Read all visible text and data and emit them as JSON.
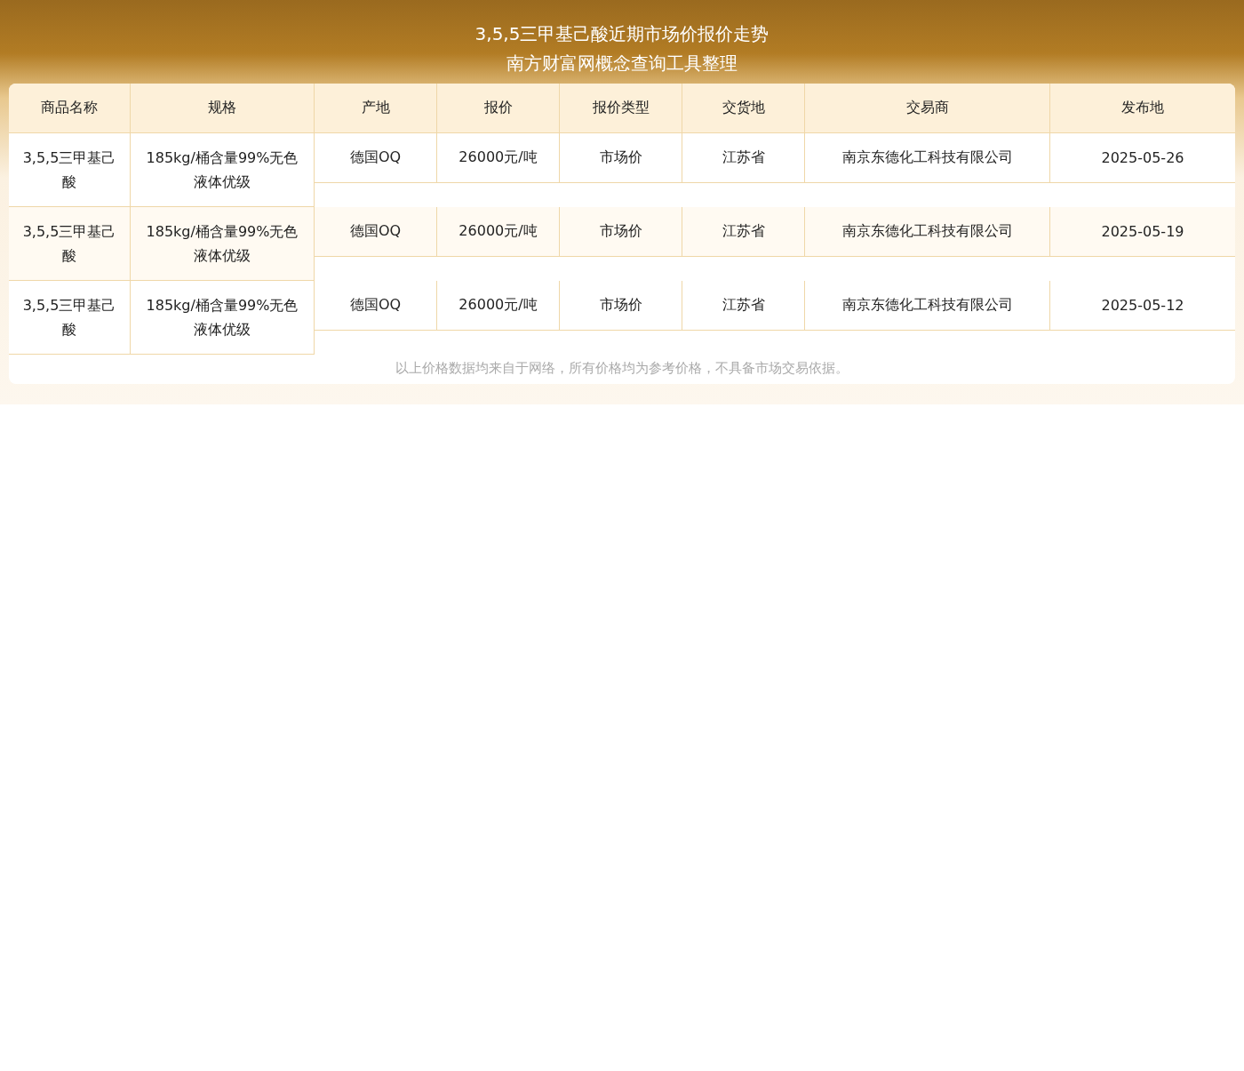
{
  "title": "3,5,5三甲基己酸近期市场价报价走势",
  "subtitle": "南方财富网概念查询工具整理",
  "table": {
    "columns": [
      "商品名称",
      "规格",
      "产地",
      "报价",
      "报价类型",
      "交货地",
      "交易商",
      "发布地"
    ],
    "rows": [
      [
        "3,5,5三甲基己酸",
        "185kg/桶含量99%无色液体优级",
        "德国OQ",
        "26000元/吨",
        "市场价",
        "江苏省",
        "南京东德化工科技有限公司",
        "2025-05-26"
      ],
      [
        "3,5,5三甲基己酸",
        "185kg/桶含量99%无色液体优级",
        "德国OQ",
        "26000元/吨",
        "市场价",
        "江苏省",
        "南京东德化工科技有限公司",
        "2025-05-19"
      ],
      [
        "3,5,5三甲基己酸",
        "185kg/桶含量99%无色液体优级",
        "德国OQ",
        "26000元/吨",
        "市场价",
        "江苏省",
        "南京东德化工科技有限公司",
        "2025-05-12"
      ]
    ]
  },
  "footnote": "以上价格数据均来自于网络，所有价格均为参考价格，不具备市场交易依据。"
}
